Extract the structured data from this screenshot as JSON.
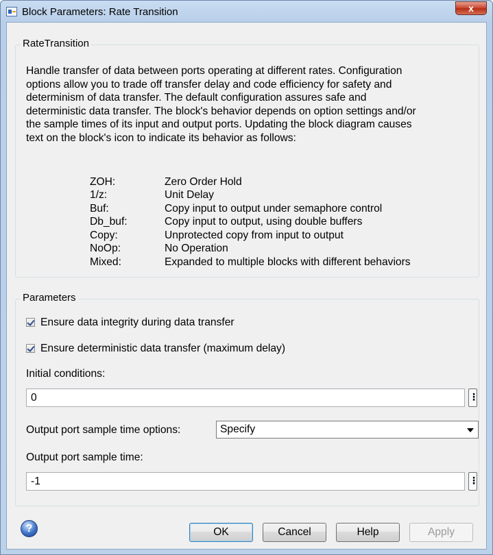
{
  "window": {
    "title": "Block Parameters: Rate Transition",
    "close_label": "x"
  },
  "block_group": {
    "legend": "RateTransition",
    "description_lines": [
      "Handle transfer of data between ports operating at different rates. Configuration",
      "options allow you to trade off transfer delay and code efficiency for safety and",
      "determinism of data transfer. The default configuration assures safe and",
      "deterministic data transfer. The block's behavior depends on option settings and/or",
      "the sample times of its input and output ports. Updating the block diagram causes",
      "text on the block's icon to indicate its behavior as follows:"
    ],
    "behaviors": [
      {
        "code": "ZOH:",
        "desc": "Zero Order Hold"
      },
      {
        "code": "1/z:",
        "desc": "Unit Delay"
      },
      {
        "code": "Buf:",
        "desc": "Copy input to output under semaphore control"
      },
      {
        "code": "Db_buf:",
        "desc": "Copy input to output, using double buffers"
      },
      {
        "code": "Copy:",
        "desc": "Unprotected copy from input to output"
      },
      {
        "code": "NoOp:",
        "desc": "No Operation"
      },
      {
        "code": "Mixed:",
        "desc": "Expanded to multiple blocks with different behaviors"
      }
    ]
  },
  "parameters": {
    "legend": "Parameters",
    "ensure_integrity": {
      "label": "Ensure data integrity during data transfer",
      "checked": true
    },
    "ensure_deterministic": {
      "label": "Ensure deterministic data transfer (maximum delay)",
      "checked": true
    },
    "initial_conditions": {
      "label": "Initial conditions:",
      "value": "0"
    },
    "sample_time_options": {
      "label": "Output port sample time options:",
      "selected": "Specify"
    },
    "sample_time": {
      "label": "Output port sample time:",
      "value": "-1"
    },
    "ellipsis_label": "⋮"
  },
  "buttons": {
    "help_icon": "?",
    "ok": "OK",
    "cancel": "Cancel",
    "help": "Help",
    "apply": "Apply"
  }
}
